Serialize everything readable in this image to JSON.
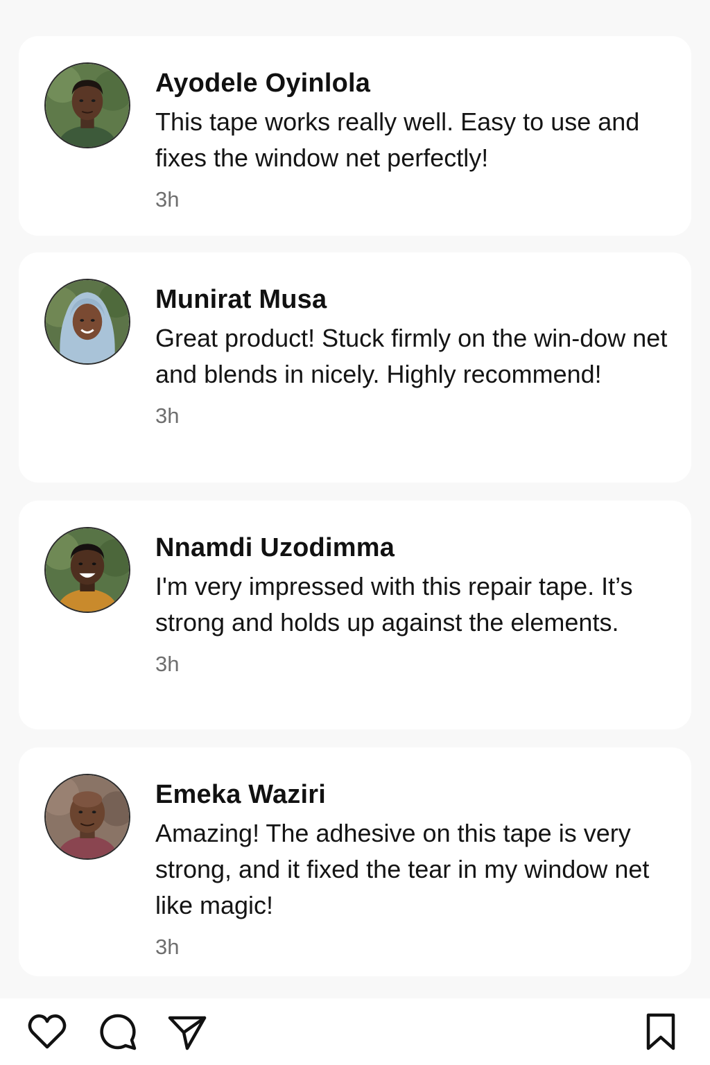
{
  "comments": [
    {
      "name": "Ayodele Oyinlola",
      "text": "This tape works really well. Easy to use and fixes the window net perfectly!",
      "time": "3h"
    },
    {
      "name": "Munirat Musa",
      "text": "Great product! Stuck firmly on the win-dow net and blends in nicely. Highly recommend!",
      "time": "3h"
    },
    {
      "name": "Nnamdi Uzodimma",
      "text": "I'm very impressed with  this repair tape. It’s strong and holds up against the elements.",
      "time": "3h"
    },
    {
      "name": "Emeka Waziri",
      "text": "Amazing! The adhesive on this tape is very strong, and it fixed the tear in my window net like magic!",
      "time": "3h"
    }
  ],
  "actions": {
    "like_icon": "heart-icon",
    "comment_icon": "comment-bubble-icon",
    "share_icon": "send-icon",
    "save_icon": "bookmark-icon"
  },
  "colors": {
    "background": "#f8f8f8",
    "card": "#ffffff",
    "text": "#111111",
    "timestamp": "#6e6e6e"
  }
}
